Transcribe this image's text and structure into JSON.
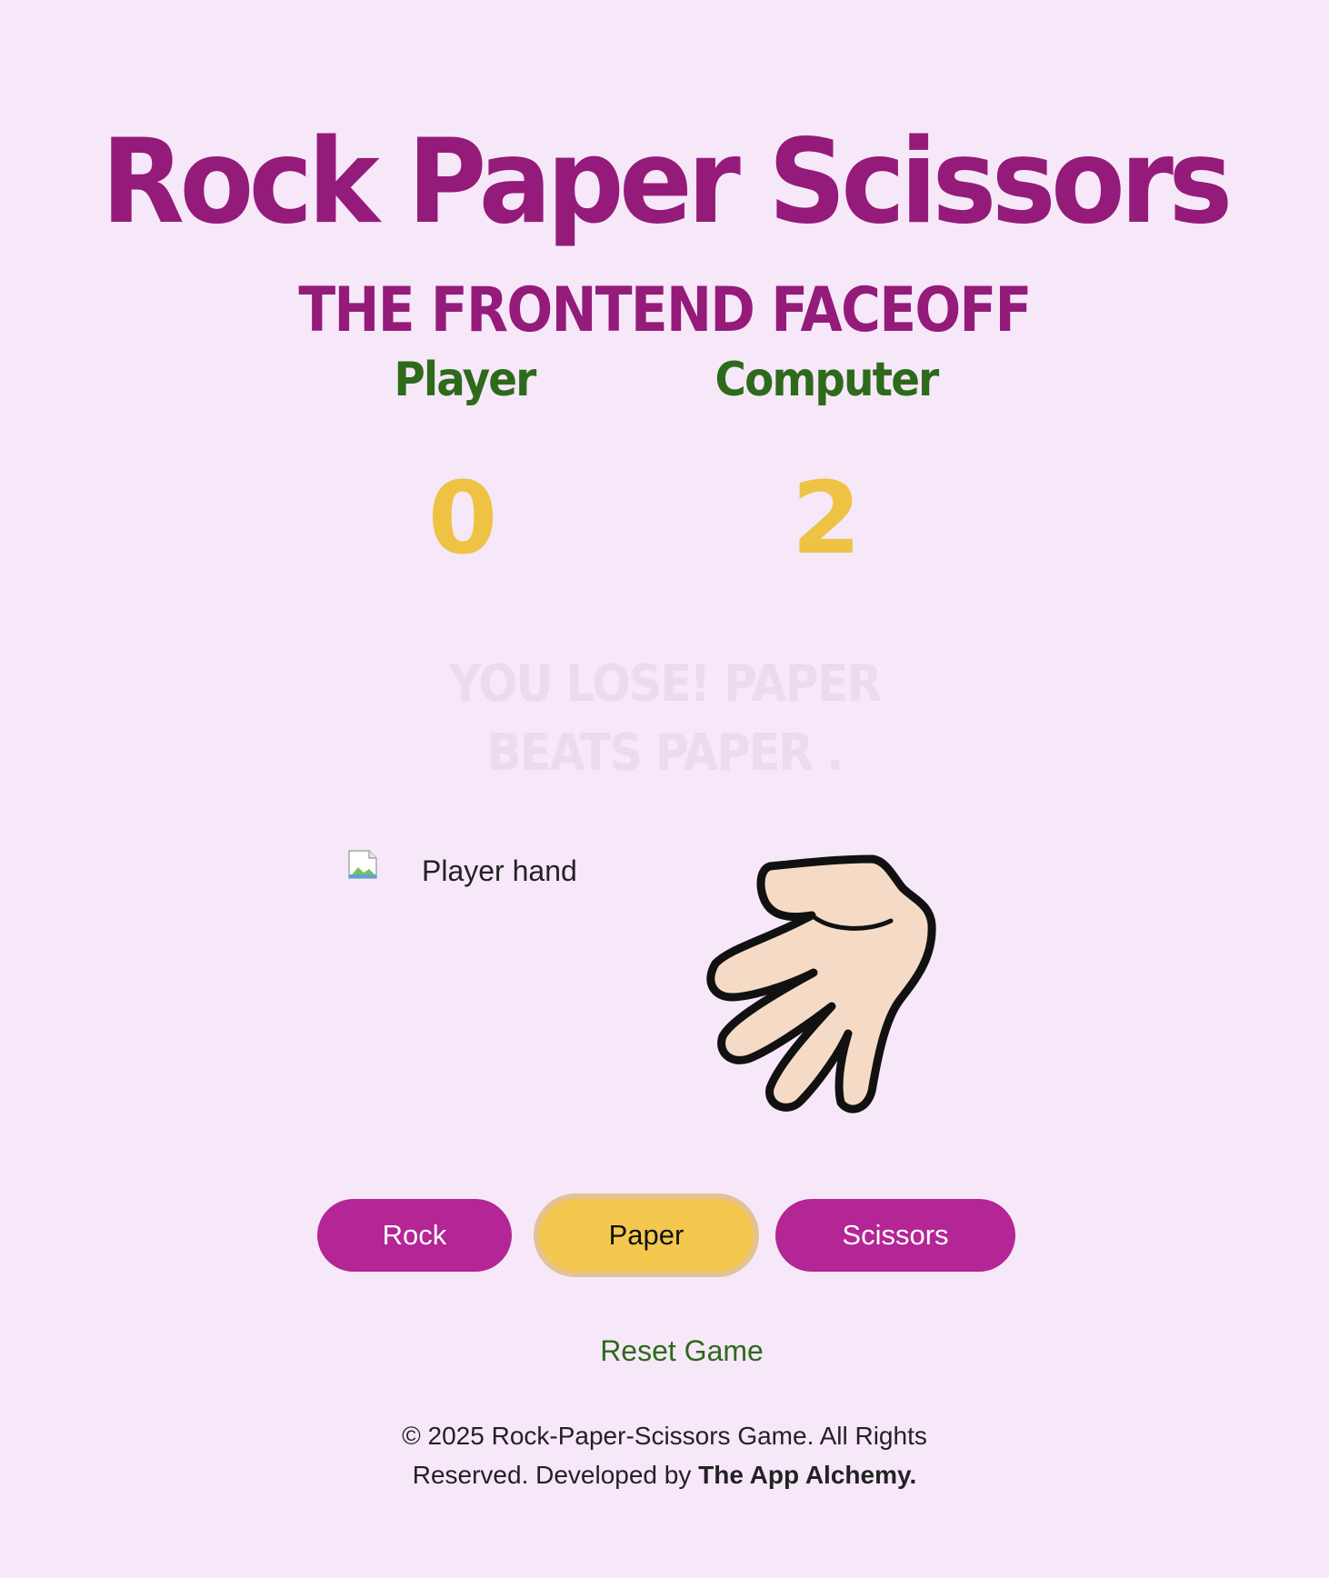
{
  "header": {
    "title": "Rock Paper Scissors",
    "subtitle": "THE FRONTEND FACEOFF"
  },
  "scoreboard": {
    "player_label": "Player",
    "computer_label": "Computer",
    "player_score": "0",
    "computer_score": "2"
  },
  "result": {
    "message": "YOU LOSE! PAPER BEATS PAPER ."
  },
  "hands": {
    "player_alt": "Player hand",
    "computer_icon": "paper-hand-icon"
  },
  "choices": {
    "rock": "Rock",
    "paper": "Paper",
    "scissors": "Scissors",
    "selected": "Paper"
  },
  "controls": {
    "reset_label": "Reset Game"
  },
  "footer": {
    "text": "© 2025 Rock-Paper-Scissors Game. All Rights Reserved. Developed by",
    "brand": "The App Alchemy."
  },
  "colors": {
    "background": "#f6e8f9",
    "title": "#941b7a",
    "label": "#2d6a1b",
    "score": "#eec243",
    "button": "#b42595",
    "button_selected": "#f4c84e"
  }
}
